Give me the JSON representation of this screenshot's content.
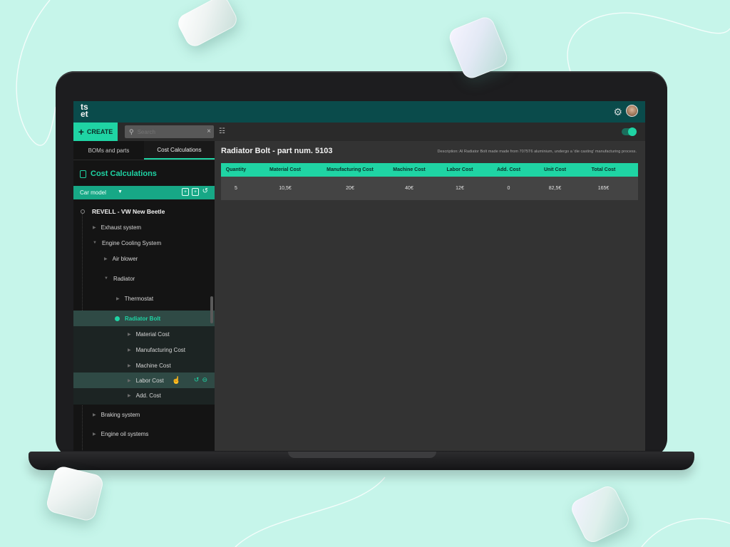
{
  "app": {
    "logo": "ts\net"
  },
  "toolbar": {
    "create_label": "CREATE",
    "search_placeholder": "Search"
  },
  "sidebar": {
    "tabs": [
      {
        "label": "BOMs and parts"
      },
      {
        "label": "Cost Calculations"
      }
    ],
    "section_title": "Cost Calculations",
    "model_selector": "Car model",
    "tree": {
      "root": "REVELL - VW New Beetle",
      "items": [
        {
          "label": "Exhaust system"
        },
        {
          "label": "Engine Cooling System"
        },
        {
          "label": "Air blower"
        },
        {
          "label": "Radiator"
        },
        {
          "label": "Thermostat"
        },
        {
          "label": "Radiator Bolt"
        },
        {
          "label": "Material Cost"
        },
        {
          "label": "Manufacturing Cost"
        },
        {
          "label": "Machine Cost"
        },
        {
          "label": "Labor Cost"
        },
        {
          "label": "Add. Cost"
        },
        {
          "label": "Braking system"
        },
        {
          "label": "Engine oil systems"
        }
      ]
    }
  },
  "main": {
    "title": "Radiator Bolt - part num. 5103",
    "description": "Description: Al Radiator Bolt made made from 7075T6 aluminium, undergo a 'die casting' manufacturing process.",
    "table": {
      "headers": [
        "Quantity",
        "Material Cost",
        "Manufacturing Cost",
        "Machine Cost",
        "Labor Cost",
        "Add. Cost",
        "Unit Cost",
        "Total Cost"
      ],
      "row": [
        "5",
        "10,5€",
        "20€",
        "40€",
        "12€",
        "0",
        "82,5€",
        "165€"
      ]
    }
  },
  "colors": {
    "accent": "#1fd4a4",
    "header": "#0a4b4b",
    "background": "#c6f5ea"
  }
}
